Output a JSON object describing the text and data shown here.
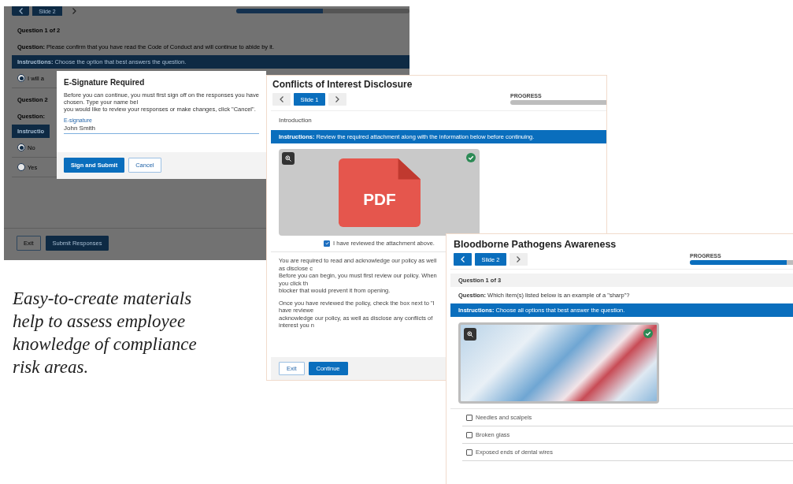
{
  "code_of_conduct_window": {
    "nav": {
      "slide": "Slide 2",
      "prev_disabled": false,
      "next_disabled": true
    },
    "progress": {
      "level": 0.5
    },
    "questions": [
      {
        "header": "Question 1 of 2",
        "question": {
          "label": "Question:",
          "text": "Please confirm that you have read the Code of Conduct and will continue to abide by it."
        },
        "instructions": {
          "label": "Instructions:",
          "text": "Choose the option that best answers the question."
        },
        "options": [
          {
            "label": "I will a",
            "selected": true
          }
        ]
      },
      {
        "header": "Question 2",
        "question": {
          "label": "Question:"
        },
        "instructions": {
          "label": "Instructio"
        },
        "options": [
          {
            "label": "No",
            "selected": true
          },
          {
            "label": "Yes",
            "selected": false
          }
        ]
      }
    ],
    "buttons": [
      {
        "label": "Exit",
        "kind": "secondary"
      },
      {
        "label": "Submit Responses",
        "kind": "primary"
      }
    ],
    "dialog": {
      "title": "E-Signature Required",
      "paragraphs": [
        "Before you can continue, you must first sign off on the responses you have chosen. Type your name bel",
        "you would like to review your responses or make changes, click \"Cancel\"."
      ],
      "field": {
        "label": "E-signature",
        "value": "John Smith"
      },
      "buttons": [
        {
          "label": "Sign and Submit",
          "kind": "primary"
        },
        {
          "label": "Cancel",
          "kind": "secondary"
        }
      ]
    }
  },
  "conflicts_window": {
    "title": "Conflicts of Interest Disclosure",
    "nav": {
      "slide": "Slide 1",
      "prev_disabled": true,
      "next_disabled": true
    },
    "progress": {
      "label": "PROGRESS",
      "level": 0
    },
    "section": {
      "kind": "intro",
      "label": "Introduction"
    },
    "instructions": {
      "label": "Instructions:",
      "text": "Review the required attachment along with the information below before continuing."
    },
    "attachment": {
      "kind": "pdf",
      "label": "PDF",
      "viewed": true
    },
    "acknowledgement": {
      "label": "I have reviewed the attachment above.",
      "checked": true
    },
    "body": [
      [
        "You are required to read and acknowledge our policy as well as disclose c",
        "Before you can begin, you must first review our policy.  When you click th",
        "blocker that would prevent it from opening."
      ],
      [
        "Once you have reviewed the policy, check the box next to \"I have reviewe",
        "acknowledge our policy, as well as disclose any conflicts of interest you n"
      ]
    ],
    "buttons": [
      {
        "label": "Exit",
        "kind": "secondary"
      },
      {
        "label": "Continue",
        "kind": "primary"
      }
    ]
  },
  "pathogens_window": {
    "title": "Bloodborne Pathogens Awareness",
    "nav": {
      "slide": "Slide 2",
      "prev_disabled": false,
      "next_disabled": true
    },
    "progress": {
      "label": "PROGRESS",
      "level": 0.92
    },
    "section": {
      "kind": "question",
      "label": "Question 1 of 3"
    },
    "question": {
      "label": "Question:",
      "text": "Which item(s) listed below is an example of a \"sharp\"?"
    },
    "instructions": {
      "label": "Instructions:",
      "text": "Choose all options that best answer the question."
    },
    "attachment": {
      "kind": "photo",
      "viewed": true
    },
    "options": [
      {
        "label": "Needles and scalpels",
        "checked": false
      },
      {
        "label": "Broken glass",
        "checked": false
      },
      {
        "label": "Exposed ends of dental wires",
        "checked": false
      }
    ]
  },
  "caption": "Easy-to-create materials help to assess employee knowledge of compliance risk areas."
}
